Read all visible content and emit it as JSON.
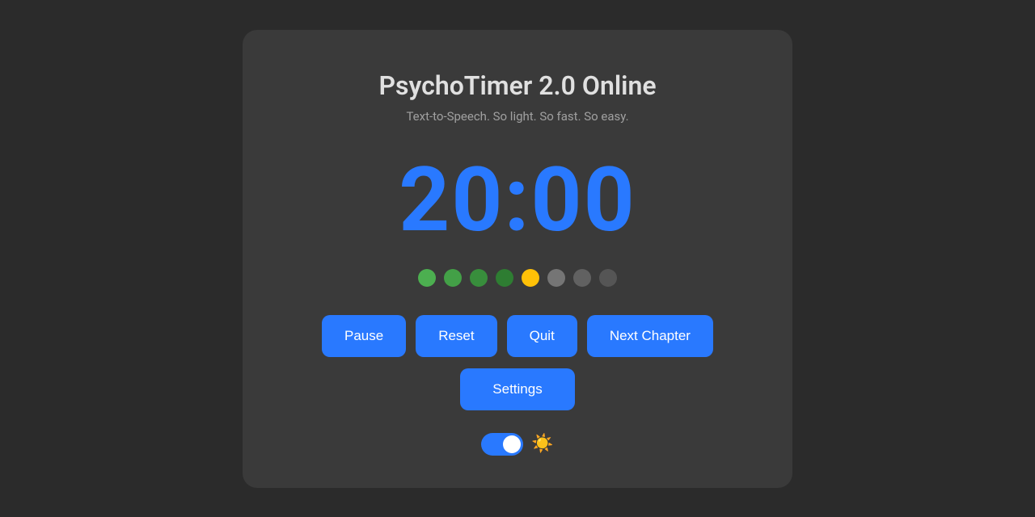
{
  "app": {
    "title": "PsychoTimer 2.0 Online",
    "subtitle": "Text-to-Speech. So light. So fast. So easy."
  },
  "timer": {
    "display": "20:00"
  },
  "dots": [
    {
      "color": "green-1"
    },
    {
      "color": "green-2"
    },
    {
      "color": "green-3"
    },
    {
      "color": "green-4"
    },
    {
      "color": "yellow"
    },
    {
      "color": "gray-1"
    },
    {
      "color": "gray-2"
    },
    {
      "color": "gray-3"
    }
  ],
  "buttons": {
    "pause": "Pause",
    "reset": "Reset",
    "quit": "Quit",
    "next_chapter": "Next Chapter",
    "settings": "Settings"
  },
  "toggle": {
    "state": "on"
  },
  "icons": {
    "sun": "☀️"
  }
}
